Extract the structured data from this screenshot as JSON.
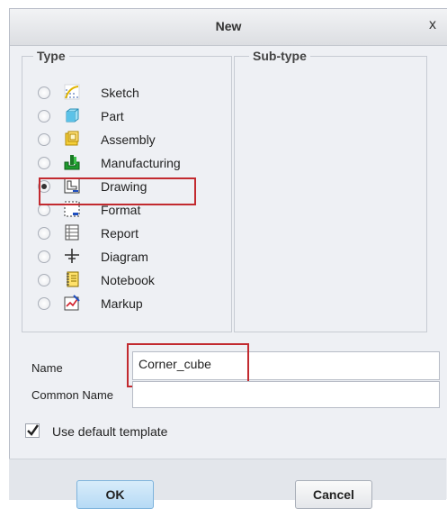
{
  "window": {
    "title": "New",
    "close_glyph": "x"
  },
  "type_group": {
    "legend": "Type",
    "selected": "Drawing",
    "items": [
      {
        "label": "Sketch",
        "icon": "sketch-icon",
        "selected": false
      },
      {
        "label": "Part",
        "icon": "part-icon",
        "selected": false
      },
      {
        "label": "Assembly",
        "icon": "assembly-icon",
        "selected": false
      },
      {
        "label": "Manufacturing",
        "icon": "manufacturing-icon",
        "selected": false
      },
      {
        "label": "Drawing",
        "icon": "drawing-icon",
        "selected": true
      },
      {
        "label": "Format",
        "icon": "format-icon",
        "selected": false
      },
      {
        "label": "Report",
        "icon": "report-icon",
        "selected": false
      },
      {
        "label": "Diagram",
        "icon": "diagram-icon",
        "selected": false
      },
      {
        "label": "Notebook",
        "icon": "notebook-icon",
        "selected": false
      },
      {
        "label": "Markup",
        "icon": "markup-icon",
        "selected": false
      }
    ]
  },
  "subtype_group": {
    "legend": "Sub-type"
  },
  "fields": {
    "name_label": "Name",
    "name_value": "Corner_cube",
    "common_name_label": "Common Name",
    "common_name_value": ""
  },
  "options": {
    "use_default_template_label": "Use default template",
    "use_default_template_checked": true
  },
  "buttons": {
    "ok": "OK",
    "cancel": "Cancel"
  },
  "colors": {
    "highlight": "#c22a2f",
    "ok_button": "#b6daf5"
  }
}
